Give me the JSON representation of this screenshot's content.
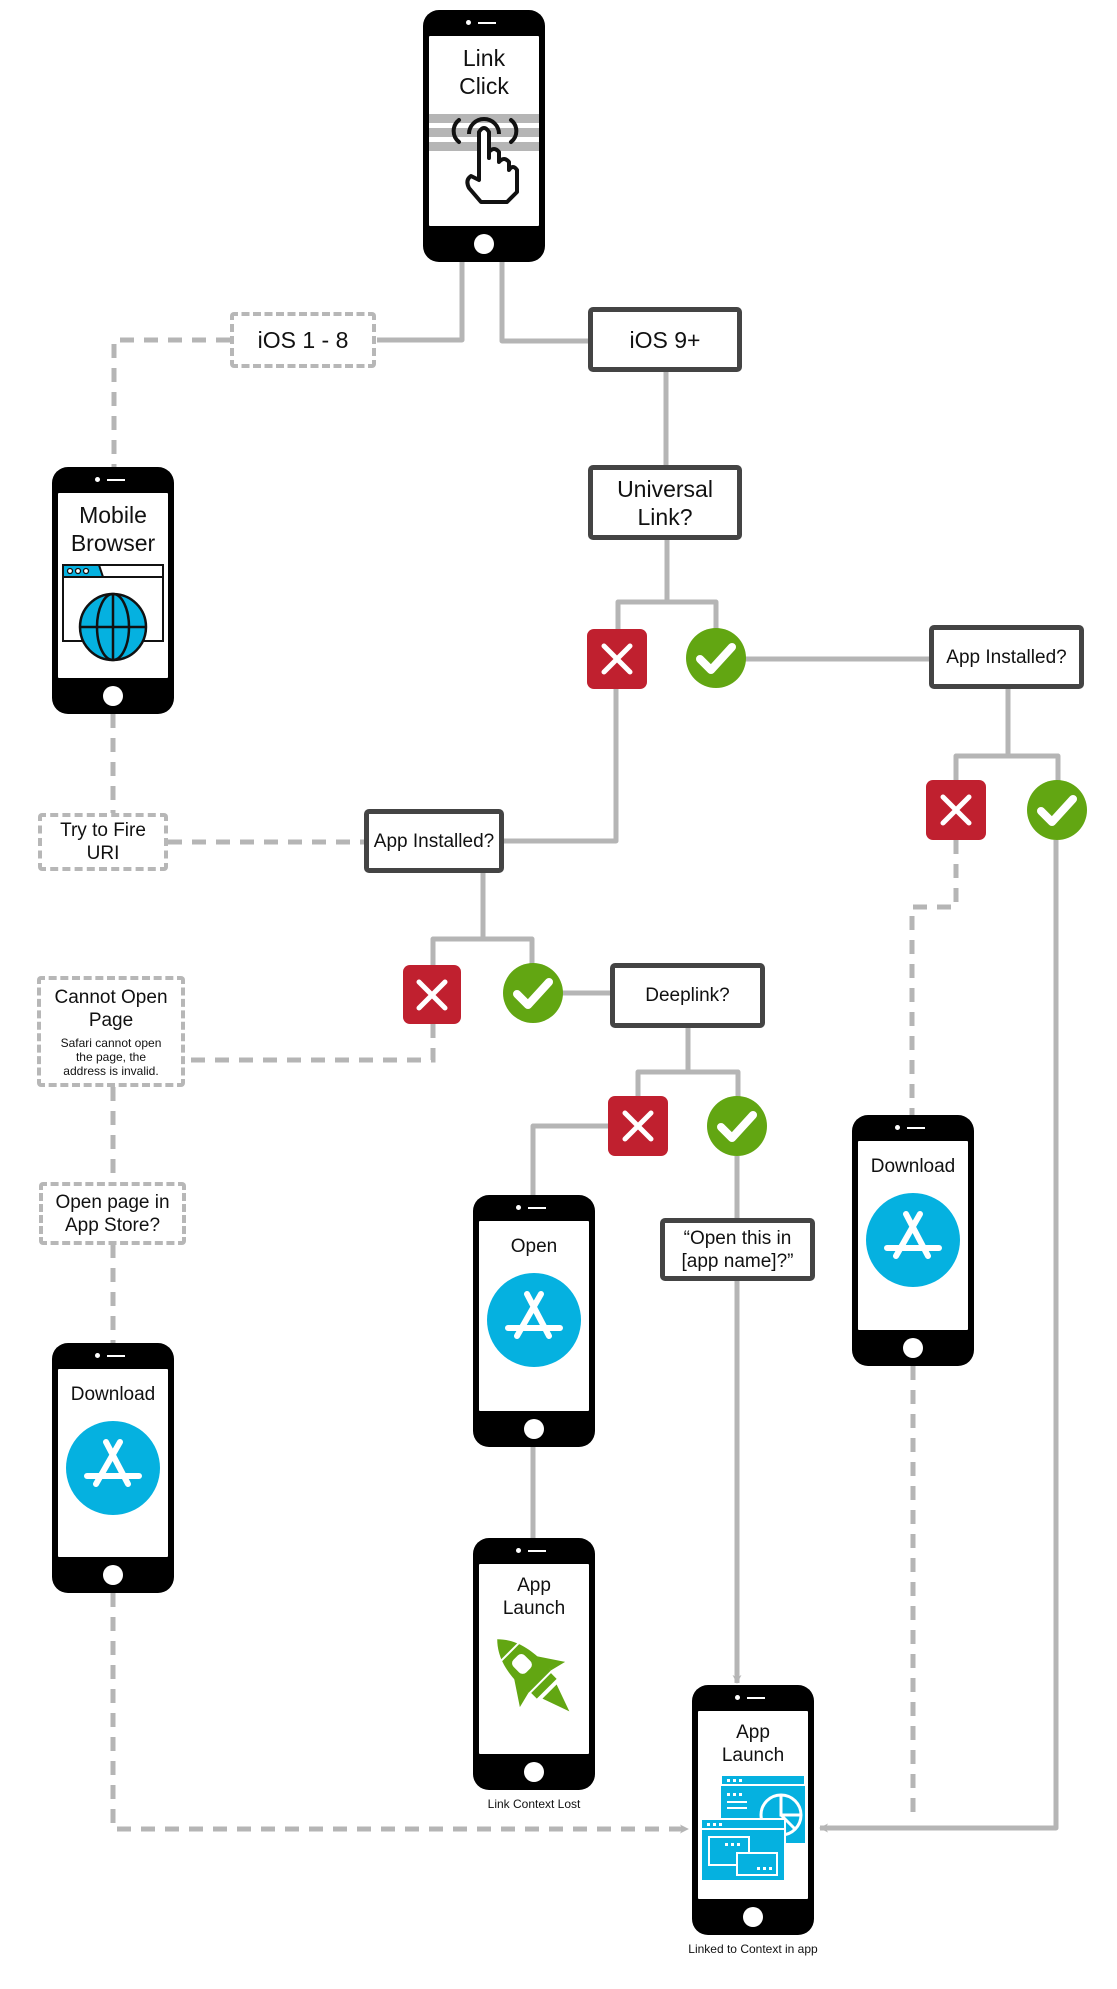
{
  "colors": {
    "no": "#c0202f",
    "yes": "#62a612",
    "accent_blue": "#05b1e0",
    "wire": "#b5b5b5",
    "box_border": "#444444"
  },
  "phones": {
    "link_click": {
      "title": "Link Click",
      "icon": "tap-finger-icon"
    },
    "mobile_browser": {
      "title": "Mobile Browser",
      "icon": "browser-globe-icon"
    },
    "download_left": {
      "title": "Download",
      "icon": "app-store-icon"
    },
    "open": {
      "title": "Open",
      "icon": "app-store-icon"
    },
    "app_launch_lost": {
      "title": "App Launch",
      "icon": "rocket-icon",
      "caption": "Link Context Lost"
    },
    "download_right": {
      "title": "Download",
      "icon": "app-store-icon"
    },
    "app_launch_context": {
      "title": "App Launch",
      "icon": "app-windows-icon",
      "caption": "Linked to Context in app"
    }
  },
  "boxes": {
    "ios_1_8": "iOS 1 - 8",
    "ios_9": "iOS 9+",
    "universal_link": "Universal Link?",
    "app_installed_right": "App Installed?",
    "app_installed_mid": "App Installed?",
    "try_fire_uri": "Try to Fire URI",
    "cannot_open_title": "Cannot Open Page",
    "cannot_open_detail": "Safari cannot open the page, the address is invalid.",
    "deeplink": "Deeplink?",
    "open_prompt": "“Open this in [app name]?”",
    "open_in_store": "Open page in App Store?"
  },
  "decisions": {
    "no_symbol": "✕",
    "yes_symbol": "✔"
  }
}
